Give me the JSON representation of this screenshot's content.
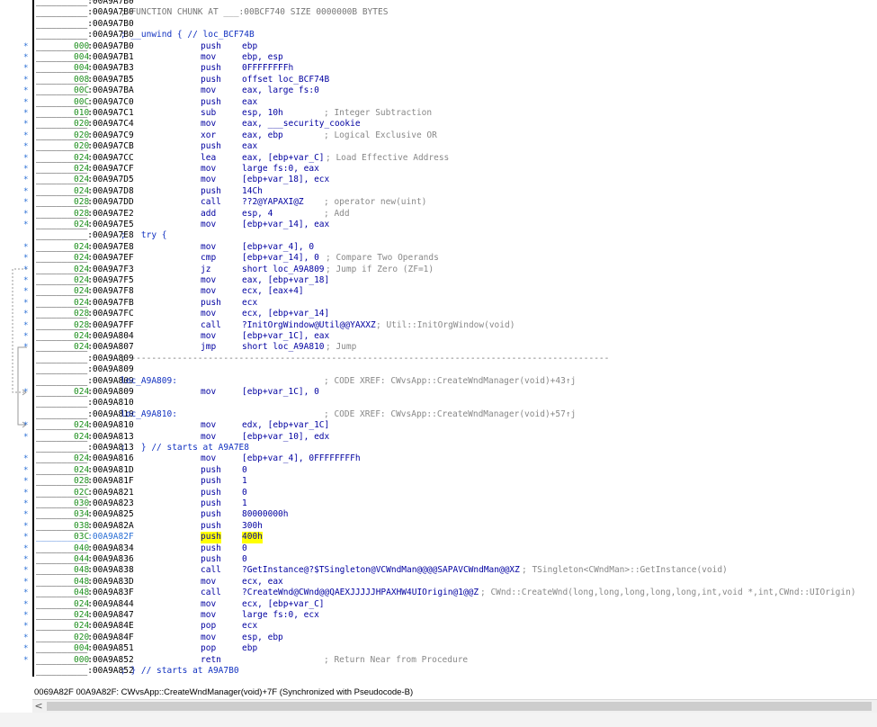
{
  "rows": [
    {
      "addr": "__________:00A9A7B0",
      "sp": "",
      "label": "",
      "mn": "",
      "op": "",
      "cmt": "",
      "dot": "",
      "partial": true
    },
    {
      "addr": "__________:00A9A7B0",
      "sp": "",
      "label": "; FUNCTION CHUNK AT ___:00BCF740 SIZE 0000000B BYTES",
      "mn": "",
      "op": "",
      "cmt": "",
      "dot": "",
      "labelComment": true
    },
    {
      "addr": "__________:00A9A7B0",
      "sp": "",
      "label": "",
      "mn": "",
      "op": "",
      "cmt": "",
      "dot": ""
    },
    {
      "addr": "__________:00A9A7B0",
      "sp": "",
      "label": "; __unwind { // loc_BCF74B",
      "mn": "",
      "op": "",
      "cmt": "",
      "dot": "",
      "labelBlue": true
    },
    {
      "addr": "__________:00A9A7B0",
      "sp": "000",
      "label": "",
      "mn": "push",
      "op": "ebp",
      "cmt": "",
      "dot": "*"
    },
    {
      "addr": "__________:00A9A7B1",
      "sp": "004",
      "label": "",
      "mn": "mov",
      "op": "ebp, esp",
      "cmt": "",
      "dot": "*"
    },
    {
      "addr": "__________:00A9A7B3",
      "sp": "004",
      "label": "",
      "mn": "push",
      "op": "0FFFFFFFFh",
      "cmt": "",
      "dot": "*"
    },
    {
      "addr": "__________:00A9A7B5",
      "sp": "008",
      "label": "",
      "mn": "push",
      "op": "offset loc_BCF74B",
      "cmt": "",
      "dot": "*"
    },
    {
      "addr": "__________:00A9A7BA",
      "sp": "00C",
      "label": "",
      "mn": "mov",
      "op": "eax, large fs:0",
      "cmt": "",
      "dot": "*"
    },
    {
      "addr": "__________:00A9A7C0",
      "sp": "00C",
      "label": "",
      "mn": "push",
      "op": "eax",
      "cmt": "",
      "dot": "*"
    },
    {
      "addr": "__________:00A9A7C1",
      "sp": "010",
      "label": "",
      "mn": "sub",
      "op": "esp, 10h",
      "cmt": "; Integer Subtraction",
      "dot": "*",
      "cmtX": 360
    },
    {
      "addr": "__________:00A9A7C4",
      "sp": "020",
      "label": "",
      "mn": "mov",
      "op": "eax, ___security_cookie",
      "cmt": "",
      "dot": "*"
    },
    {
      "addr": "__________:00A9A7C9",
      "sp": "020",
      "label": "",
      "mn": "xor",
      "op": "eax, ebp",
      "cmt": "; Logical Exclusive OR",
      "dot": "*",
      "cmtX": 360
    },
    {
      "addr": "__________:00A9A7CB",
      "sp": "020",
      "label": "",
      "mn": "push",
      "op": "eax",
      "cmt": "",
      "dot": "*"
    },
    {
      "addr": "__________:00A9A7CC",
      "sp": "024",
      "label": "",
      "mn": "lea",
      "op": "eax, [ebp+var_C]",
      "cmt": "; Load Effective Address",
      "dot": "*",
      "cmtX": 362
    },
    {
      "addr": "__________:00A9A7CF",
      "sp": "024",
      "label": "",
      "mn": "mov",
      "op": "large fs:0, eax",
      "cmt": "",
      "dot": "*"
    },
    {
      "addr": "__________:00A9A7D5",
      "sp": "024",
      "label": "",
      "mn": "mov",
      "op": "[ebp+var_18], ecx",
      "cmt": "",
      "dot": "*"
    },
    {
      "addr": "__________:00A9A7D8",
      "sp": "024",
      "label": "",
      "mn": "push",
      "op": "14Ch",
      "cmt": "",
      "dot": "*"
    },
    {
      "addr": "__________:00A9A7DD",
      "sp": "028",
      "label": "",
      "mn": "call",
      "op": "??2@YAPAXI@Z",
      "cmt": "; operator new(uint)",
      "dot": "*",
      "cmtX": 360
    },
    {
      "addr": "__________:00A9A7E2",
      "sp": "028",
      "label": "",
      "mn": "add",
      "op": "esp, 4",
      "cmt": "; Add",
      "dot": "*",
      "cmtX": 360
    },
    {
      "addr": "__________:00A9A7E5",
      "sp": "024",
      "label": "",
      "mn": "mov",
      "op": "[ebp+var_14], eax",
      "cmt": "",
      "dot": "*"
    },
    {
      "addr": "__________:00A9A7E8",
      "sp": "",
      "label": ";   try {",
      "mn": "",
      "op": "",
      "cmt": "",
      "dot": "",
      "labelBlue": true
    },
    {
      "addr": "__________:00A9A7E8",
      "sp": "024",
      "label": "",
      "mn": "mov",
      "op": "[ebp+var_4], 0",
      "cmt": "",
      "dot": "*"
    },
    {
      "addr": "__________:00A9A7EF",
      "sp": "024",
      "label": "",
      "mn": "cmp",
      "op": "[ebp+var_14], 0",
      "cmt": "; Compare Two Operands",
      "dot": "*",
      "cmtX": 362
    },
    {
      "addr": "__________:00A9A7F3",
      "sp": "024",
      "label": "",
      "mn": "jz",
      "op": "short loc_A9A809",
      "cmt": "; Jump if Zero (ZF=1)",
      "dot": "*",
      "cmtX": 362
    },
    {
      "addr": "__________:00A9A7F5",
      "sp": "024",
      "label": "",
      "mn": "mov",
      "op": "eax, [ebp+var_18]",
      "cmt": "",
      "dot": "*"
    },
    {
      "addr": "__________:00A9A7F8",
      "sp": "024",
      "label": "",
      "mn": "mov",
      "op": "ecx, [eax+4]",
      "cmt": "",
      "dot": "*"
    },
    {
      "addr": "__________:00A9A7FB",
      "sp": "024",
      "label": "",
      "mn": "push",
      "op": "ecx",
      "cmt": "",
      "dot": "*"
    },
    {
      "addr": "__________:00A9A7FC",
      "sp": "028",
      "label": "",
      "mn": "mov",
      "op": "ecx, [ebp+var_14]",
      "cmt": "",
      "dot": "*"
    },
    {
      "addr": "__________:00A9A7FF",
      "sp": "028",
      "label": "",
      "mn": "call",
      "op": "?InitOrgWindow@Util@@YAXXZ",
      "cmt": "; Util::InitOrgWindow(void)",
      "dot": "*",
      "cmtX": 418
    },
    {
      "addr": "__________:00A9A804",
      "sp": "024",
      "label": "",
      "mn": "mov",
      "op": "[ebp+var_1C], eax",
      "cmt": "",
      "dot": "*"
    },
    {
      "addr": "__________:00A9A807",
      "sp": "024",
      "label": "",
      "mn": "jmp",
      "op": "short loc_A9A810",
      "cmt": "; Jump",
      "dot": "*",
      "cmtX": 362
    },
    {
      "addr": "__________:00A9A809",
      "sp": "",
      "label": "; ---------------------------------------------------------------------------------------------",
      "mn": "",
      "op": "",
      "cmt": "",
      "dot": "",
      "labelComment": true
    },
    {
      "addr": "__________:00A9A809",
      "sp": "",
      "label": "",
      "mn": "",
      "op": "",
      "cmt": "",
      "dot": ""
    },
    {
      "addr": "__________:00A9A809",
      "sp": "",
      "label": "loc_A9A809:",
      "mn": "",
      "op": "",
      "cmt": "; CODE XREF: CWvsApp::CreateWndManager(void)+43↑j",
      "dot": "",
      "cmtX": 360,
      "labelBlue": true
    },
    {
      "addr": "__________:00A9A809",
      "sp": "024",
      "label": "",
      "mn": "mov",
      "op": "[ebp+var_1C], 0",
      "cmt": "",
      "dot": "*"
    },
    {
      "addr": "__________:00A9A810",
      "sp": "",
      "label": "",
      "mn": "",
      "op": "",
      "cmt": "",
      "dot": ""
    },
    {
      "addr": "__________:00A9A810",
      "sp": "",
      "label": "loc_A9A810:",
      "mn": "",
      "op": "",
      "cmt": "; CODE XREF: CWvsApp::CreateWndManager(void)+57↑j",
      "dot": "",
      "cmtX": 360,
      "labelBlue": true
    },
    {
      "addr": "__________:00A9A810",
      "sp": "024",
      "label": "",
      "mn": "mov",
      "op": "edx, [ebp+var_1C]",
      "cmt": "",
      "dot": "*"
    },
    {
      "addr": "__________:00A9A813",
      "sp": "024",
      "label": "",
      "mn": "mov",
      "op": "[ebp+var_10], edx",
      "cmt": "",
      "dot": "*"
    },
    {
      "addr": "__________:00A9A813",
      "sp": "",
      "label": ";   } // starts at A9A7E8",
      "mn": "",
      "op": "",
      "cmt": "",
      "dot": "",
      "labelBlue": true
    },
    {
      "addr": "__________:00A9A816",
      "sp": "024",
      "label": "",
      "mn": "mov",
      "op": "[ebp+var_4], 0FFFFFFFFh",
      "cmt": "",
      "dot": "*"
    },
    {
      "addr": "__________:00A9A81D",
      "sp": "024",
      "label": "",
      "mn": "push",
      "op": "0",
      "cmt": "",
      "dot": "*"
    },
    {
      "addr": "__________:00A9A81F",
      "sp": "028",
      "label": "",
      "mn": "push",
      "op": "1",
      "cmt": "",
      "dot": "*"
    },
    {
      "addr": "__________:00A9A821",
      "sp": "02C",
      "label": "",
      "mn": "push",
      "op": "0",
      "cmt": "",
      "dot": "*"
    },
    {
      "addr": "__________:00A9A823",
      "sp": "030",
      "label": "",
      "mn": "push",
      "op": "1",
      "cmt": "",
      "dot": "*"
    },
    {
      "addr": "__________:00A9A825",
      "sp": "034",
      "label": "",
      "mn": "push",
      "op": "80000000h",
      "cmt": "",
      "dot": "*"
    },
    {
      "addr": "__________:00A9A82A",
      "sp": "038",
      "label": "",
      "mn": "push",
      "op": "300h",
      "cmt": "",
      "dot": "*"
    },
    {
      "addr": "__________:00A9A82F",
      "sp": "03C",
      "label": "",
      "mn": "push",
      "op": "400h",
      "cmt": "",
      "dot": "*",
      "highlight": true,
      "selected": true
    },
    {
      "addr": "__________:00A9A834",
      "sp": "040",
      "label": "",
      "mn": "push",
      "op": "0",
      "cmt": "",
      "dot": "*"
    },
    {
      "addr": "__________:00A9A836",
      "sp": "044",
      "label": "",
      "mn": "push",
      "op": "0",
      "cmt": "",
      "dot": "*"
    },
    {
      "addr": "__________:00A9A838",
      "sp": "048",
      "label": "",
      "mn": "call",
      "op": "?GetInstance@?$TSingleton@VCWndMan@@@@SAPAVCWndMan@@XZ",
      "cmt": "; TSingleton<CWndMan>::GetInstance(void)",
      "dot": "*",
      "cmtX": 580
    },
    {
      "addr": "__________:00A9A83D",
      "sp": "048",
      "label": "",
      "mn": "mov",
      "op": "ecx, eax",
      "cmt": "",
      "dot": "*"
    },
    {
      "addr": "__________:00A9A83F",
      "sp": "048",
      "label": "",
      "mn": "call",
      "op": "?CreateWnd@CWnd@@QAEXJJJJJHPAXHW4UIOrigin@1@@Z",
      "cmt": "; CWnd::CreateWnd(long,long,long,long,long,int,void *,int,CWnd::UIOrigin)",
      "dot": "*",
      "cmtX": 534
    },
    {
      "addr": "__________:00A9A844",
      "sp": "024",
      "label": "",
      "mn": "mov",
      "op": "ecx, [ebp+var_C]",
      "cmt": "",
      "dot": "*"
    },
    {
      "addr": "__________:00A9A847",
      "sp": "024",
      "label": "",
      "mn": "mov",
      "op": "large fs:0, ecx",
      "cmt": "",
      "dot": "*"
    },
    {
      "addr": "__________:00A9A84E",
      "sp": "024",
      "label": "",
      "mn": "pop",
      "op": "ecx",
      "cmt": "",
      "dot": "*"
    },
    {
      "addr": "__________:00A9A84F",
      "sp": "020",
      "label": "",
      "mn": "mov",
      "op": "esp, ebp",
      "cmt": "",
      "dot": "*"
    },
    {
      "addr": "__________:00A9A851",
      "sp": "004",
      "label": "",
      "mn": "pop",
      "op": "ebp",
      "cmt": "",
      "dot": "*"
    },
    {
      "addr": "__________:00A9A852",
      "sp": "000",
      "label": "",
      "mn": "retn",
      "op": "",
      "cmt": "; Return Near from Procedure",
      "dot": "*",
      "cmtX": 360
    },
    {
      "addr": "__________:00A9A852",
      "sp": "",
      "label": "; } // starts at A9A7B0",
      "mn": "",
      "op": "",
      "cmt": "",
      "dot": "",
      "labelBlue": true
    }
  ],
  "status": {
    "text": "0069A82F 00A9A82F: CWvsApp::CreateWndManager(void)+7F (Synchronized with Pseudocode-B)"
  },
  "scroll": {
    "left_arrow": "<"
  },
  "colors": {
    "highlight": "#ffff00",
    "mnemonic": "#0000a0",
    "stack": "#1d8f1d",
    "comment": "#777777",
    "dot": "#2a6fd6"
  }
}
